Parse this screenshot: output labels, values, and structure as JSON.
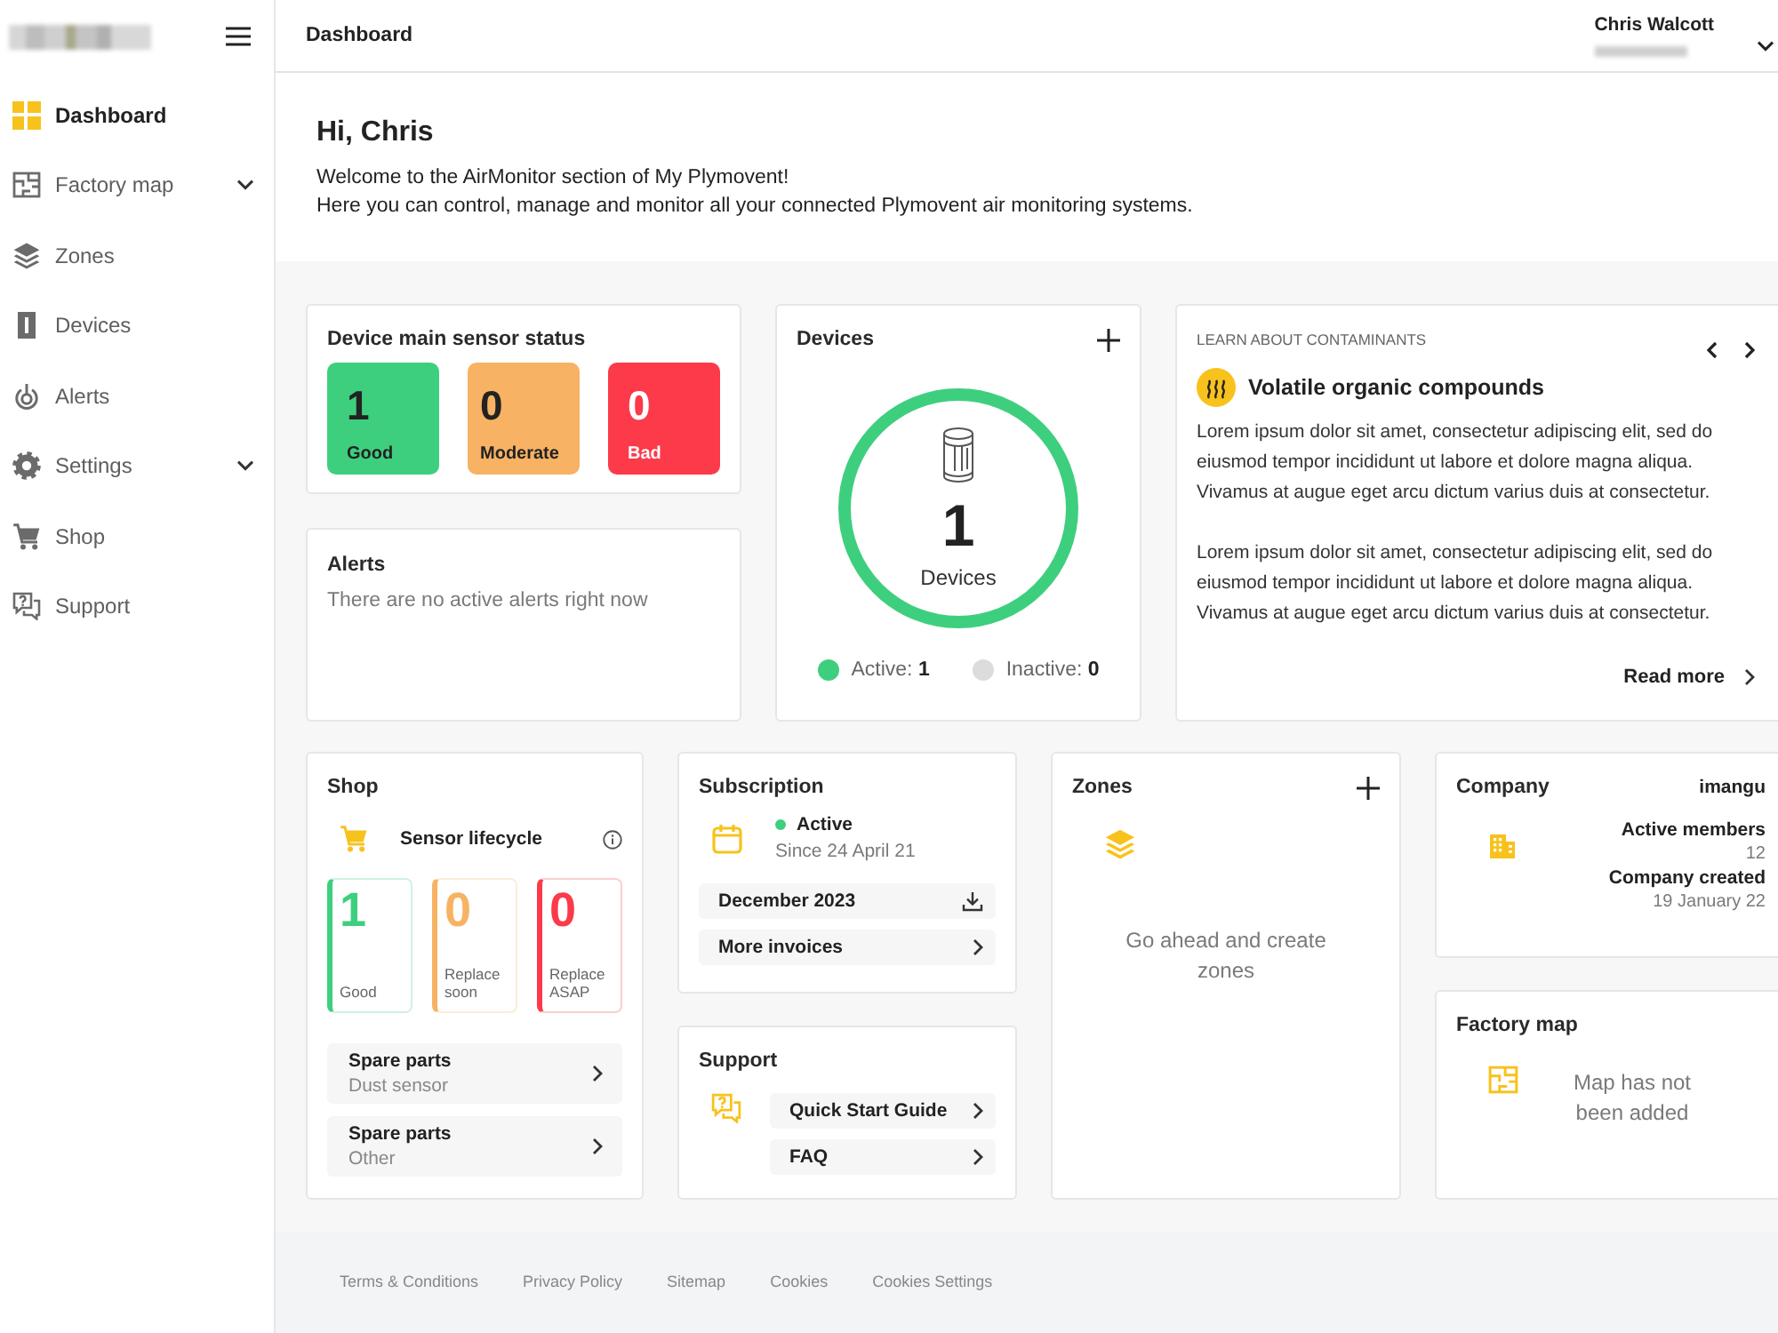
{
  "sidebar": {
    "items": [
      {
        "label": "Dashboard",
        "selected": true,
        "expandable": false
      },
      {
        "label": "Factory map",
        "selected": false,
        "expandable": true
      },
      {
        "label": "Zones",
        "selected": false,
        "expandable": false
      },
      {
        "label": "Devices",
        "selected": false,
        "expandable": false
      },
      {
        "label": "Alerts",
        "selected": false,
        "expandable": false
      },
      {
        "label": "Settings",
        "selected": false,
        "expandable": true
      },
      {
        "label": "Shop",
        "selected": false,
        "expandable": false
      },
      {
        "label": "Support",
        "selected": false,
        "expandable": false
      }
    ]
  },
  "header": {
    "title": "Dashboard",
    "user_name": "Chris Walcott"
  },
  "greeting": {
    "heading": "Hi, Chris",
    "lines": [
      "Welcome to the AirMonitor section of My Plymovent!",
      "Here you can control, manage and monitor all your connected Plymovent air monitoring systems."
    ]
  },
  "sensor_status": {
    "title": "Device main sensor status",
    "tiles": [
      {
        "count": "1",
        "label": "Good",
        "color": "#3ecf7e"
      },
      {
        "count": "0",
        "label": "Moderate",
        "color": "#f7b263"
      },
      {
        "count": "0",
        "label": "Bad",
        "color": "#fc3a4a"
      }
    ]
  },
  "alerts": {
    "title": "Alerts",
    "message": "There are no active alerts right now"
  },
  "devices": {
    "title": "Devices",
    "level": 1,
    "count": "1",
    "count_label": "Devices",
    "stats": [
      {
        "text": "Active: **1**",
        "color": "#3ecf7e"
      },
      {
        "text": "Inactive: **0**",
        "color": "#dcdcdc"
      }
    ]
  },
  "learn": {
    "eyebrow": "LEARN ABOUT CONTAMINANTS",
    "title": "Volatile organic compounds",
    "paragraphs": [
      "Lorem ipsum dolor sit amet, consectetur adipiscing elit, sed do eiusmod tempor incididunt ut labore et dolore magna aliqua. Vivamus at augue eget arcu dictum varius duis at consectetur.",
      "Lorem ipsum dolor sit amet, consectetur adipiscing elit, sed do eiusmod tempor incididunt ut labore et dolore magna aliqua. Vivamus at augue eget arcu dictum varius duis at consectetur."
    ],
    "read_more": "Read more"
  },
  "shop": {
    "title": "Shop",
    "section": "Sensor lifecycle",
    "tiles": [
      {
        "count": "1",
        "label": "Good",
        "color": "#3ecf7e"
      },
      {
        "count": "0",
        "label": "Replace soon",
        "color": "#f7b263"
      },
      {
        "count": "0",
        "label": "Replace ASAP",
        "color": "#fc3a4a"
      }
    ],
    "links": [
      {
        "title": "Spare parts",
        "subtitle": "Dust sensor"
      },
      {
        "title": "Spare parts",
        "subtitle": "Other"
      }
    ]
  },
  "subscription": {
    "title": "Subscription",
    "status": "Active",
    "active": true,
    "since": "Since 24 April 21",
    "invoices": [
      {
        "label": "December 2023",
        "kind": "download"
      },
      {
        "label": "More invoices",
        "kind": "link"
      }
    ]
  },
  "support": {
    "title": "Support",
    "links": [
      "Quick Start Guide",
      "FAQ"
    ]
  },
  "zones": {
    "title": "Zones",
    "message": "Go ahead and create zones"
  },
  "company": {
    "title": "Company",
    "name": "imangu",
    "fields": [
      {
        "label": "Active members",
        "value": "12"
      },
      {
        "label": "Company created",
        "value": "19 January 22"
      }
    ]
  },
  "factory_map": {
    "title": "Factory map",
    "message": "Map has not been added"
  },
  "footer": {
    "links": [
      "Terms & Conditions",
      "Privacy Policy",
      "Sitemap",
      "Cookies",
      "Cookies Settings"
    ]
  }
}
